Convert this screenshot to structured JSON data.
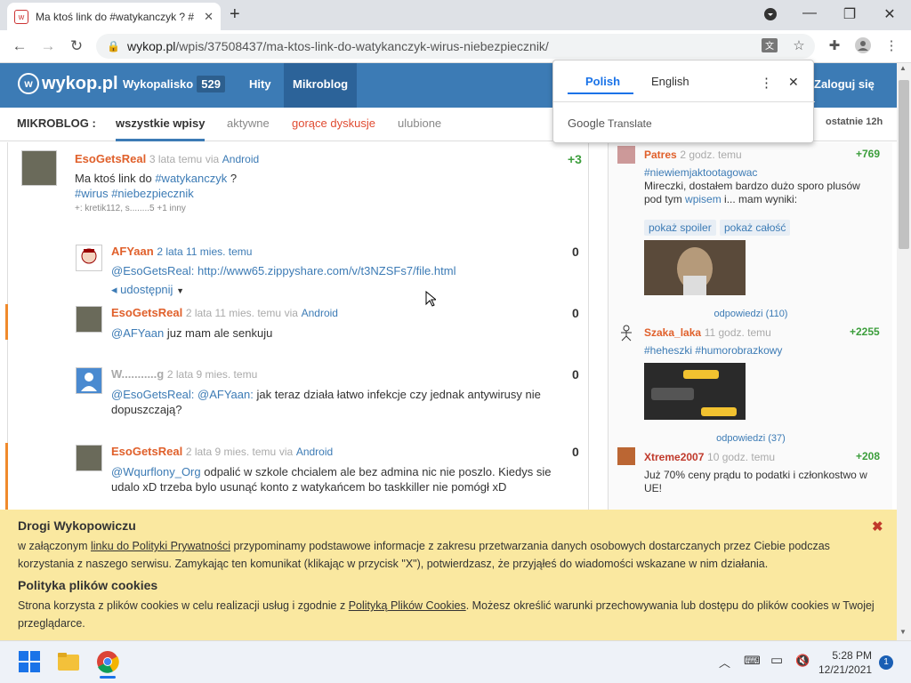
{
  "browser": {
    "tab_title": "Ma ktoś link do #watykanczyk ? #",
    "url_domain": "wykop.pl",
    "url_path": "/wpis/37508437/ma-ktos-link-do-watykanczyk-wirus-niebezpiecznik/"
  },
  "header": {
    "logo": "wykop.pl",
    "nav": [
      {
        "label": "Wykopalisko",
        "count": "529"
      },
      {
        "label": "Hity"
      },
      {
        "label": "Mikroblog"
      }
    ],
    "login": "Zaloguj się"
  },
  "subnav": {
    "label": "MIKROBLOG :",
    "tabs": [
      "wszystkie wpisy",
      "aktywne",
      "gorące dyskusje",
      "ulubione"
    ],
    "right": "ostatnie 12h"
  },
  "translate_popup": {
    "tab_polish": "Polish",
    "tab_english": "English",
    "footer_google": "Google",
    "footer_translate": "Translate"
  },
  "main_post": {
    "author": "EsoGetsReal",
    "time": "3 lata temu",
    "via_prefix": "via",
    "via": "Android",
    "score": "+3",
    "line1": "Ma ktoś link do ",
    "tag1": "#watykanczyk",
    "line1_end": " ?",
    "tag2": "#wirus",
    "tag3": "#niebezpiecznik",
    "voters": "+: kretik112, s........5 +1 inny"
  },
  "comments": [
    {
      "author": "AFYaan",
      "time": "2 lata 11 mies. temu",
      "score": "0",
      "mention": "@EsoGetsReal",
      "sep": ": ",
      "text": "http://www65.zippyshare.com/v/t3NZSFs7/file.html",
      "share": "udostępnij"
    },
    {
      "author": "EsoGetsReal",
      "time": "2 lata 11 mies. temu",
      "via_prefix": "via",
      "via": "Android",
      "score": "0",
      "mention": "@AFYaan",
      "text": " juz mam ale senkuju"
    },
    {
      "author": "W...........g",
      "time": "2 lata 9 mies. temu",
      "score": "0",
      "mention": "@EsoGetsReal",
      "mention2": "@AFYaan",
      "sep": ": ",
      "sep2": ": ",
      "text": " jak teraz działa łatwo infekcje czy jednak antywirusy nie dopuszczają?"
    },
    {
      "author": "EsoGetsReal",
      "time": "2 lata 9 mies. temu",
      "via_prefix": "via",
      "via": "Android",
      "score": "0",
      "mention": "@Wqurflony_Org",
      "text": " odpalić w szkole chcialem ale bez admina nic nie poszlo. Kiedys sie udalo xD trzeba bylo usunąć konto z watykańcem bo taskkiller nie pomógł xD"
    }
  ],
  "sidebar": [
    {
      "author": "Patres",
      "time": "2 godz. temu",
      "score": "+769",
      "tag": "#niewiemjaktootagowac",
      "text1": "Mireczki, dostałem bardzo dużo sporo plusów pod tym ",
      "link": "wpisem",
      "text2": " i... mam wyniki:",
      "pill1": "pokaż spoiler",
      "pill2": "pokaż całość",
      "replies": "odpowiedzi (110)"
    },
    {
      "author": "Szaka_laka",
      "time": "11 godz. temu",
      "score": "+2255",
      "tag": "#heheszki",
      "tag2": "#humorobrazkowy",
      "replies": "odpowiedzi (37)"
    },
    {
      "author": "Xtreme2007",
      "time": "10 godz. temu",
      "score": "+208",
      "text1": "Już 70% ceny prądu to podatki i członkostwo w UE!"
    }
  ],
  "cookie": {
    "title1": "Drogi Wykopowiczu",
    "p1a": "w załączonym ",
    "p1link": "linku do Polityki Prywatności",
    "p1b": " przypominamy podstawowe informacje z zakresu przetwarzania danych osobowych dostarczanych przez Ciebie podczas korzystania z naszego serwisu. Zamykając ten komunikat (klikając w przycisk \"X\"), potwierdzasz, że przyjąłeś do wiadomości wskazane w nim działania.",
    "title2": "Polityka plików cookies",
    "p2a": "Strona korzysta z plików cookies w celu realizacji usług i zgodnie z ",
    "p2link": "Polityką Plików Cookies",
    "p2b": ". Możesz określić warunki przechowywania lub dostępu do plików cookies w Twojej przeglądarce."
  },
  "taskbar": {
    "time": "5:28 PM",
    "date": "12/21/2021",
    "notifications": "1"
  }
}
